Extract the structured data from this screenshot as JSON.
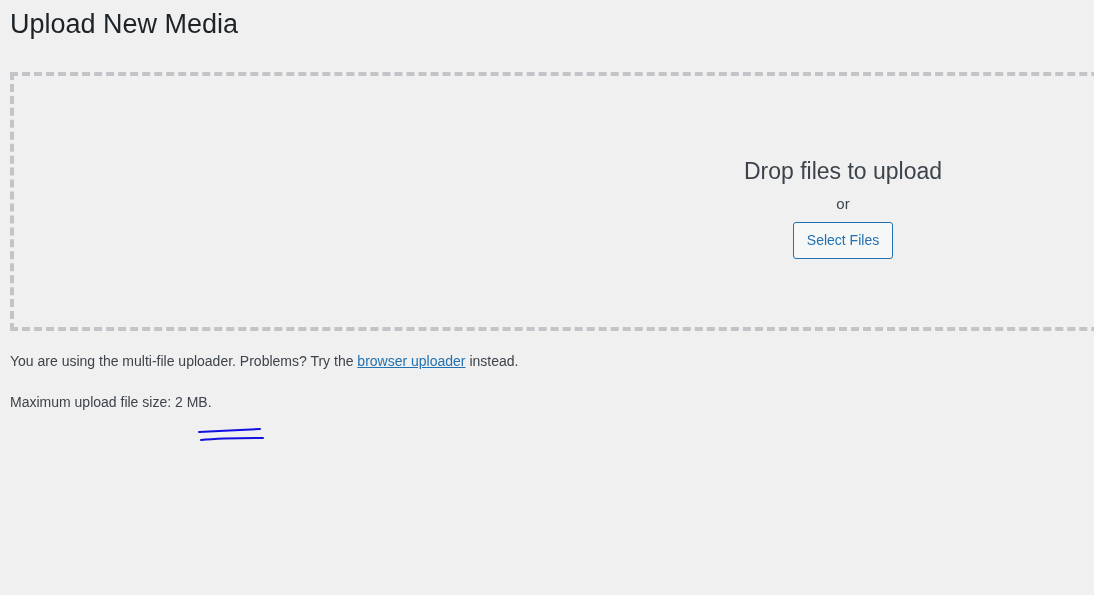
{
  "title": "Upload New Media",
  "dropzone": {
    "heading": "Drop files to upload",
    "separator": "or",
    "button": "Select Files"
  },
  "notice": {
    "before": "You are using the multi-file uploader. Problems? Try the ",
    "link": "browser uploader",
    "after": " instead."
  },
  "max_size": "Maximum upload file size: 2 MB."
}
